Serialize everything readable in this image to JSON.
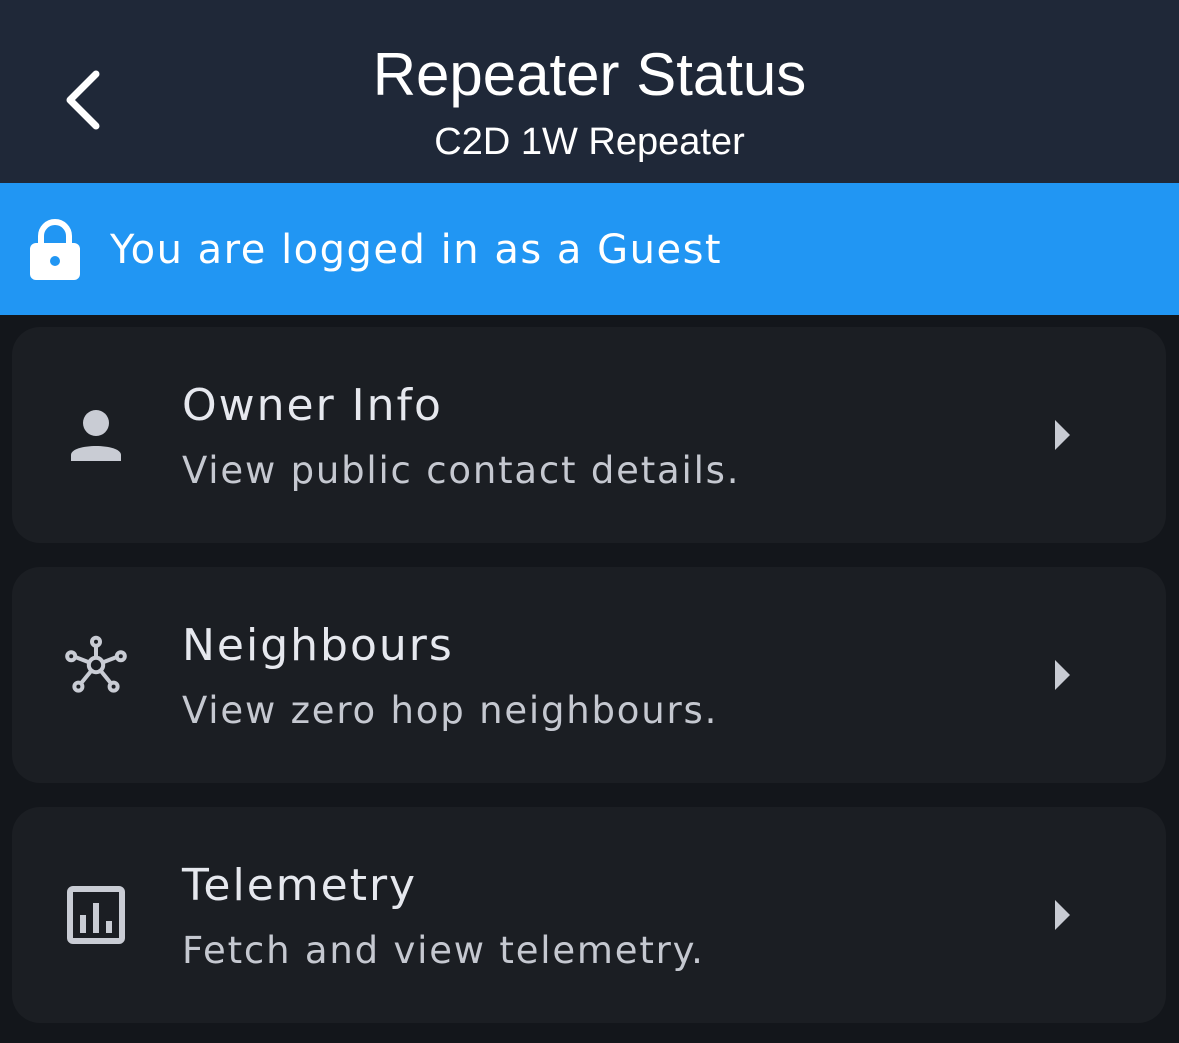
{
  "header": {
    "back_icon": "chevron-left-icon",
    "title": "Repeater Status",
    "subtitle": "C2D 1W Repeater",
    "background": "#1f2838"
  },
  "banner": {
    "icon": "lock-icon",
    "text": "You are logged in as a Guest",
    "background": "#2196f3"
  },
  "menu": {
    "items": [
      {
        "icon": "person-icon",
        "title": "Owner Info",
        "description": "View public contact details.",
        "chevron_icon": "chevron-right-icon"
      },
      {
        "icon": "network-hub-icon",
        "title": "Neighbours",
        "description": "View zero hop neighbours.",
        "chevron_icon": "chevron-right-icon"
      },
      {
        "icon": "bar-chart-icon",
        "title": "Telemetry",
        "description": "Fetch and view telemetry.",
        "chevron_icon": "chevron-right-icon"
      }
    ]
  },
  "colors": {
    "page_background": "#13161b",
    "card_background": "#1b1e23",
    "icon_color": "#c9ccd4"
  }
}
